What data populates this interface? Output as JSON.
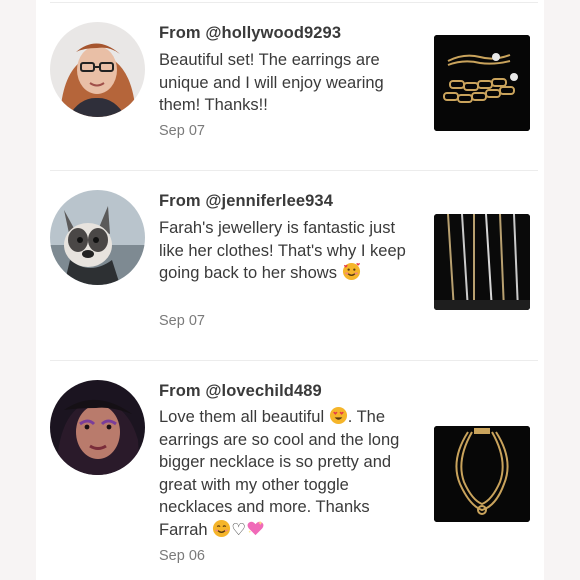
{
  "reviews": [
    {
      "from": "From @hollywood9293",
      "text": "Beautiful set! The earrings are unique and I will enjoy wearing them! Thanks!!",
      "date": "Sep 07",
      "avatar_icon": "reviewer-avatar-photo",
      "thumb_icon": "chain-bracelets-photo"
    },
    {
      "from": "From @jenniferlee934",
      "text_before": "Farah's jewellery is fantastic just like her clothes! That's why I keep going back to her shows",
      "emoji1": "smiling-face-with-hearts-emoji",
      "date": "Sep 07",
      "avatar_icon": "french-bulldog-avatar-photo",
      "thumb_icon": "necklaces-on-display-photo"
    },
    {
      "from": "From @lovechild489",
      "text_a": "Love them all beautiful ",
      "text_b": ". The earrings are so cool and the long bigger necklace is so pretty and great with my other toggle necklaces and more. Thanks Farrah ",
      "emoji_heart_eyes": "heart-eyes-emoji",
      "emoji_smile": "smiling-face-emoji",
      "emoji_white_heart": "♡",
      "emoji_sparkle_heart": "sparkling-heart-emoji",
      "date": "Sep 06",
      "avatar_icon": "reviewer-avatar-photo",
      "thumb_icon": "toggle-necklace-photo"
    }
  ],
  "colors": {
    "background": "#f7f4f4",
    "panel": "#ffffff",
    "text": "#3a3a3a",
    "muted": "#7a7a7a"
  }
}
